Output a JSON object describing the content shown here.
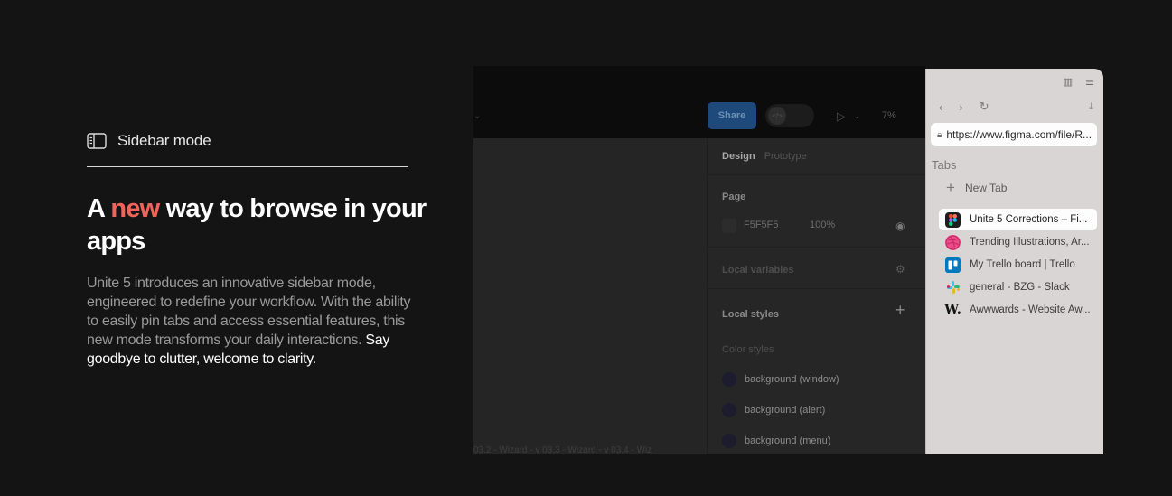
{
  "feature": {
    "label": "Sidebar mode",
    "headline_pre": "A ",
    "headline_accent": "new",
    "headline_post": " way to browse in your apps",
    "body": "Unite 5 introduces an innovative sidebar mode, engineered to redefine your workflow. With the ability to easily pin tabs and access essential features, this new mode transforms your daily interactions. ",
    "body_emphasis": "Say goodbye to clutter, welcome to clarity.",
    "accent_color": "#f0645a"
  },
  "figma": {
    "share_label": "Share",
    "zoom": "7%",
    "tabs": {
      "design": "Design",
      "prototype": "Prototype"
    },
    "page": {
      "title": "Page",
      "color": "F5F5F5",
      "opacity": "100%"
    },
    "local_variables": "Local variables",
    "local_styles": "Local styles",
    "color_styles": "Color styles",
    "styles": [
      "background (window)",
      "background (alert)",
      "background (menu)"
    ],
    "footer": "03.2 - Wizard - v    03.3 - Wizard - v    03.4 - Wiz"
  },
  "sidebar": {
    "url": "https://www.figma.com/file/R...",
    "tabs_heading": "Tabs",
    "new_tab": "New Tab",
    "tabs": [
      {
        "label": "Unite 5 Corrections – Fi...",
        "icon": "figma-icon",
        "active": true
      },
      {
        "label": "Trending Illustrations, Ar...",
        "icon": "dribbble-icon",
        "active": false
      },
      {
        "label": "My Trello board | Trello",
        "icon": "trello-icon",
        "active": false
      },
      {
        "label": "general - BZG - Slack",
        "icon": "slack-icon",
        "active": false
      },
      {
        "label": "Awwwards - Website Aw...",
        "icon": "awwwards-icon",
        "active": false
      }
    ]
  }
}
